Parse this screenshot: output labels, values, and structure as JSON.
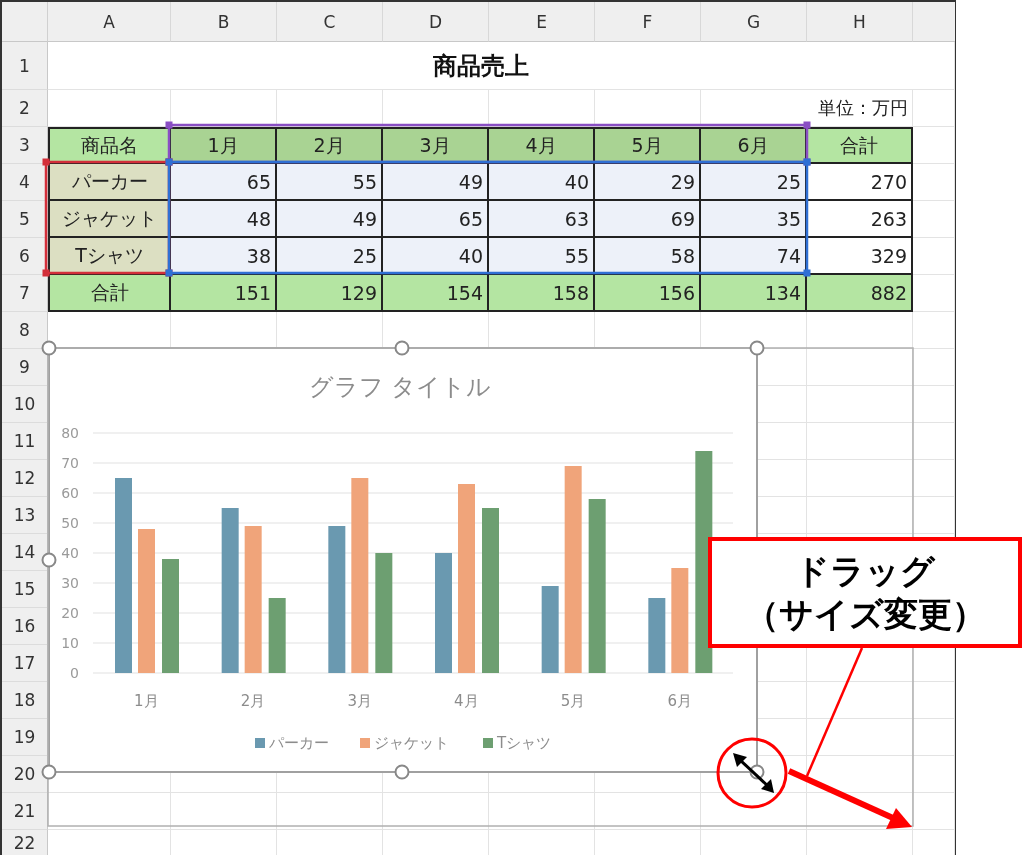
{
  "sheet": {
    "columns": [
      "A",
      "B",
      "C",
      "D",
      "E",
      "F",
      "G",
      "H"
    ],
    "rows": [
      "1",
      "2",
      "3",
      "4",
      "5",
      "6",
      "7",
      "8",
      "9",
      "10",
      "11",
      "12",
      "13",
      "14",
      "15",
      "16",
      "17",
      "18",
      "19",
      "20",
      "21",
      "22"
    ]
  },
  "title": "商品売上",
  "unit": "単位：万円",
  "table": {
    "header": [
      "商品名",
      "1月",
      "2月",
      "3月",
      "4月",
      "5月",
      "6月",
      "合計"
    ],
    "rows": [
      {
        "name": "パーカー",
        "values": [
          "65",
          "55",
          "49",
          "40",
          "29",
          "25"
        ],
        "total": "270"
      },
      {
        "name": "ジャケット",
        "values": [
          "48",
          "49",
          "65",
          "63",
          "69",
          "35"
        ],
        "total": "263"
      },
      {
        "name": "Tシャツ",
        "values": [
          "38",
          "25",
          "40",
          "55",
          "58",
          "74"
        ],
        "total": "329"
      }
    ],
    "totals": {
      "label": "合計",
      "values": [
        "151",
        "129",
        "154",
        "158",
        "156",
        "134"
      ],
      "total": "882"
    }
  },
  "chart": {
    "chart_data": {
      "type": "bar",
      "title": "グラフ タイトル",
      "categories": [
        "1月",
        "2月",
        "3月",
        "4月",
        "5月",
        "6月"
      ],
      "ylim": [
        0,
        80
      ],
      "yticks": [
        {
          "value": 0,
          "label": "0"
        },
        {
          "value": 10,
          "label": "10"
        },
        {
          "value": 20,
          "label": "20"
        },
        {
          "value": 30,
          "label": "30"
        },
        {
          "value": 40,
          "label": "40"
        },
        {
          "value": 50,
          "label": "50"
        },
        {
          "value": 60,
          "label": "60"
        },
        {
          "value": 70,
          "label": "70"
        },
        {
          "value": 80,
          "label": "80"
        }
      ],
      "grid": true,
      "legend": true,
      "series": [
        {
          "name": "パーカー",
          "color": "#6a99b0",
          "values": [
            65,
            55,
            49,
            40,
            29,
            25
          ]
        },
        {
          "name": "ジャケット",
          "color": "#f0a47a",
          "values": [
            48,
            49,
            65,
            63,
            69,
            35
          ]
        },
        {
          "name": "Tシャツ",
          "color": "#6d9f71",
          "values": [
            38,
            25,
            40,
            55,
            58,
            74
          ]
        }
      ]
    }
  },
  "callout": {
    "lines": [
      "ドラッグ",
      "（サイズ変更）"
    ]
  }
}
